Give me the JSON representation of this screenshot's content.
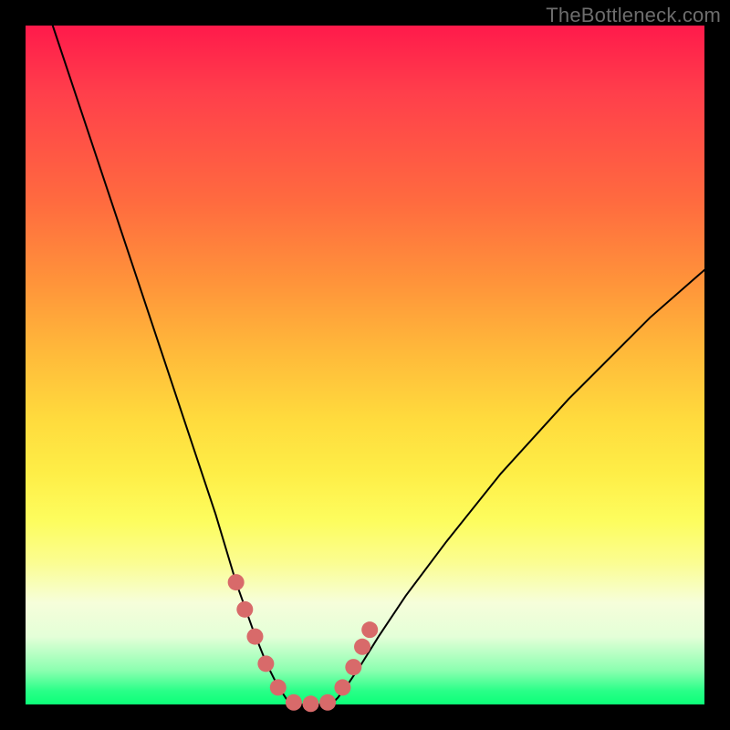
{
  "watermark": "TheBottleneck.com",
  "chart_data": {
    "type": "line",
    "title": "",
    "xlabel": "",
    "ylabel": "",
    "xlim": [
      0,
      100
    ],
    "ylim": [
      0,
      100
    ],
    "grid": false,
    "legend": false,
    "series": [
      {
        "name": "left-curve",
        "color": "#000000",
        "x": [
          4,
          8,
          12,
          16,
          20,
          24,
          28,
          31,
          33.5,
          35.5,
          37,
          38.3,
          39
        ],
        "y": [
          100,
          88,
          76,
          64,
          52,
          40,
          28,
          18,
          11,
          6,
          3,
          1,
          0
        ]
      },
      {
        "name": "right-curve",
        "color": "#000000",
        "x": [
          45,
          46,
          47.5,
          49.5,
          52,
          56,
          62,
          70,
          80,
          92,
          100
        ],
        "y": [
          0,
          1,
          3,
          6,
          10,
          16,
          24,
          34,
          45,
          57,
          64
        ]
      },
      {
        "name": "flat-bottom",
        "color": "#000000",
        "x": [
          39,
          45
        ],
        "y": [
          0,
          0
        ]
      }
    ],
    "markers": {
      "name": "highlight-dots",
      "color": "#d86a6a",
      "radius": 9,
      "points_xy": [
        [
          31.0,
          18.0
        ],
        [
          32.3,
          14.0
        ],
        [
          33.8,
          10.0
        ],
        [
          35.4,
          6.0
        ],
        [
          37.2,
          2.5
        ],
        [
          39.5,
          0.3
        ],
        [
          42.0,
          0.1
        ],
        [
          44.5,
          0.3
        ],
        [
          46.7,
          2.5
        ],
        [
          48.3,
          5.5
        ],
        [
          49.6,
          8.5
        ],
        [
          50.7,
          11.0
        ]
      ]
    }
  }
}
